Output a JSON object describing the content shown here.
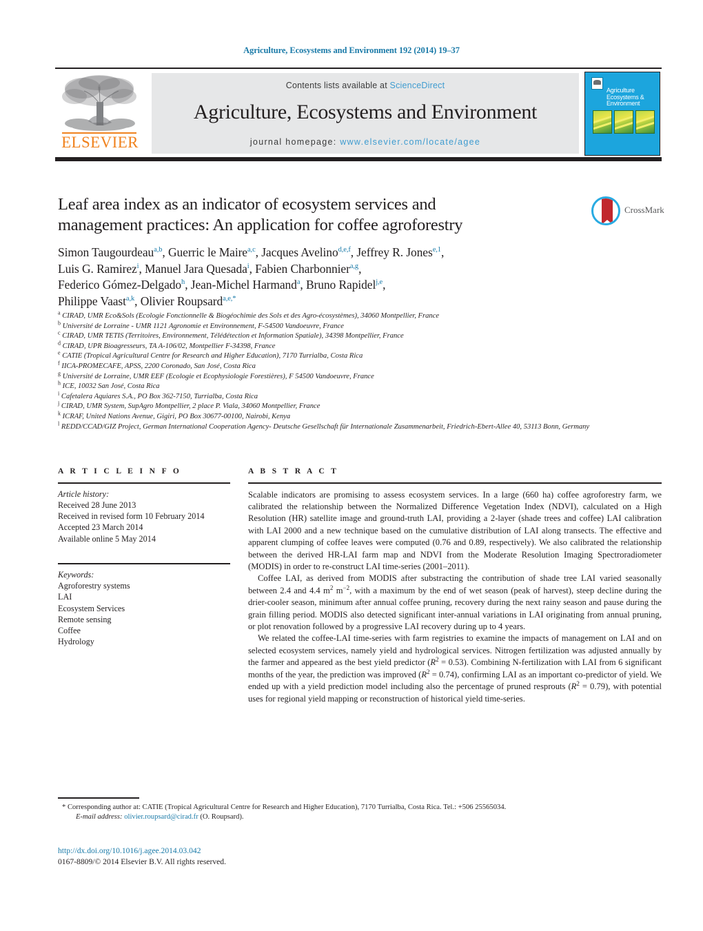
{
  "running_head": "Agriculture, Ecosystems and Environment 192 (2014) 19–37",
  "masthead": {
    "contents_prefix": "Contents lists available at ",
    "sciencedirect": "ScienceDirect",
    "journal_title": "Agriculture, Ecosystems and Environment",
    "homepage_prefix": "journal homepage: ",
    "homepage_url": "www.elsevier.com/locate/agee",
    "publisher": "ELSEVIER",
    "cover_title": "Agriculture Ecosystems & Environment",
    "accent_blue": "#3f9cd0",
    "header_blue": "#1a7aa8",
    "elsevier_orange": "#f0821e",
    "cover_background": "#1ca5dd"
  },
  "article": {
    "title_line1": "Leaf area index as an indicator of ecosystem services and",
    "title_line2": "management practices: An application for coffee agroforestry",
    "author_lines": [
      "Simon Taugourdeau<sup>a,b</sup>, Guerric le Maire<sup>a,c</sup>, Jacques Avelino<sup>d,e,f</sup>, Jeffrey R. Jones<sup>e,1</sup>,",
      "Luis G. Ramirez<sup>i</sup>, Manuel Jara Quesada<sup>i</sup>, Fabien Charbonnier<sup>a,g</sup>,",
      "Federico Gómez-Delgado<sup>h</sup>, Jean-Michel Harmand<sup>a</sup>, Bruno Rapidel<sup>j,e</sup>,",
      "Philippe Vaast<sup>a,k</sup>, Olivier Roupsard<sup>a,e,*</sup>"
    ],
    "crossmark_label": "CrossMark"
  },
  "affiliations": [
    "<sup>a</sup> CIRAD, UMR Eco&Sols (Ecologie Fonctionnelle & Biogéochimie des Sols et des Agro-écosystèmes), 34060 Montpellier, France",
    "<sup>b</sup> Université de Lorraine - UMR 1121 Agronomie et Environnement, F-54500 Vandoeuvre, France",
    "<sup>c</sup> CIRAD, UMR TETIS (Territoires, Environnement, Télédétection et Information Spatiale), 34398 Montpellier, France",
    "<sup>d</sup> CIRAD, UPR Bioagresseurs, TA A-106/02, Montpellier F-34398, France",
    "<sup>e</sup> CATIE (Tropical Agricultural Centre for Research and Higher Education), 7170 Turrialba, Costa Rica",
    "<sup>f</sup> IICA-PROMECAFE, APSS, 2200 Coronado, San José, Costa Rica",
    "<sup>g</sup> Université de Lorraine, UMR EEF (Ecologie et Ecophysiologie Forestières), F 54500 Vandoeuvre, France",
    "<sup>h</sup> ICE, 10032 San José, Costa Rica",
    "<sup>i</sup> Cafetalera Aquiares S.A., PO Box 362-7150, Turrialba, Costa Rica",
    "<sup>j</sup> CIRAD, UMR System, SupAgro Montpellier, 2 place P. Viala, 34060 Montpellier, France",
    "<sup>k</sup> ICRAF, United Nations Avenue, Gigiri, PO Box 30677-00100, Nairobi, Kenya",
    "<sup>l</sup> REDD/CCAD/GIZ Project, German International Cooperation Agency- Deutsche Gesellschaft für Internationale Zusammenarbeit, Friedrich-Ebert-Allee 40, 53113 Bonn, Germany"
  ],
  "article_info": {
    "heading": "A R T I C L E   I N F O",
    "history_label": "Article history:",
    "history": [
      "Received 28 June 2013",
      "Received in revised form 10 February 2014",
      "Accepted 23 March 2014",
      "Available online 5 May 2014"
    ],
    "keywords_label": "Keywords:",
    "keywords": [
      "Agroforestry systems",
      "LAI",
      "Ecosystem Services",
      "Remote sensing",
      "Coffee",
      "Hydrology"
    ]
  },
  "abstract": {
    "heading": "A B S T R A C T",
    "paragraphs": [
      "Scalable indicators are promising to assess ecosystem services. In a large (660 ha) coffee agroforestry farm, we calibrated the relationship between the Normalized Difference Vegetation Index (NDVI), calculated on a High Resolution (HR) satellite image and ground-truth LAI, providing a 2-layer (shade trees and coffee) LAI calibration with LAI 2000 and a new technique based on the cumulative distribution of LAI along transects. The effective and apparent clumping of coffee leaves were computed (0.76 and 0.89, respectively). We also calibrated the relationship between the derived HR-LAI farm map and NDVI from the Moderate Resolution Imaging Spectroradiometer (MODIS) in order to re-construct LAI time-series (2001–2011).",
      "Coffee LAI, as derived from MODIS after substracting the contribution of shade tree LAI varied seasonally between 2.4 and 4.4 m<sup>2</sup> m<sup>−2</sup>, with a maximum by the end of wet season (peak of harvest), steep decline during the drier-cooler season, minimum after annual coffee pruning, recovery during the next rainy season and pause during the grain filling period. MODIS also detected significant inter-annual variations in LAI originating from annual pruning, or plot renovation followed by a progressive LAI recovery during up to 4 years.",
      "We related the coffee-LAI time-series with farm registries to examine the impacts of management on LAI and on selected ecosystem services, namely yield and hydrological services. Nitrogen fertilization was adjusted annually by the farmer and appeared as the best yield predictor (<i>R</i><sup>2</sup> = 0.53). Combining N-fertilization with LAI from 6 significant months of the year, the prediction was improved (<i>R</i><sup>2</sup> = 0.74), confirming LAI as an important co-predictor of yield. We ended up with a yield prediction model including also the percentage of pruned resprouts (<i>R</i><sup>2</sup> = 0.79), with potential uses for regional yield mapping or reconstruction of historical yield time-series."
    ]
  },
  "footer": {
    "corresponding_note": "* Corresponding author at: CATIE (Tropical Agricultural Centre for Research and Higher Education), 7170 Turrialba, Costa Rica. Tel.: +506 25565034.",
    "email_label": "E-mail address:",
    "email": "olivier.roupsard@cirad.fr",
    "email_suffix": "(O. Roupsard).",
    "doi": "http://dx.doi.org/10.1016/j.agee.2014.03.042",
    "copyright": "0167-8809/© 2014 Elsevier B.V. All rights reserved."
  }
}
